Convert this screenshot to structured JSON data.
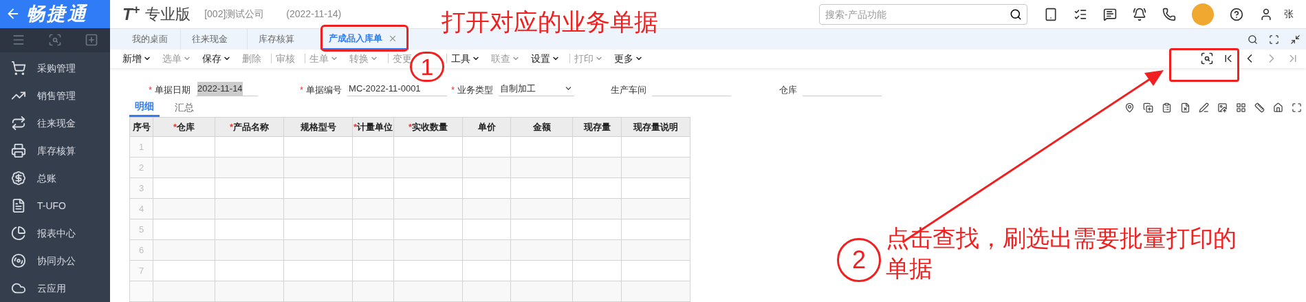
{
  "sidebar": {
    "logo": "畅捷通",
    "items": [
      {
        "label": "采购管理"
      },
      {
        "label": "销售管理"
      },
      {
        "label": "往来现金"
      },
      {
        "label": "库存核算"
      },
      {
        "label": "总账"
      },
      {
        "label": "T-UFO"
      },
      {
        "label": "报表中心"
      },
      {
        "label": "协同办公"
      },
      {
        "label": "云应用"
      }
    ]
  },
  "header": {
    "product_mark": "T$^{+}$",
    "edition": "专业版",
    "company": "[002]测试公司",
    "date": "(2022-11-14)",
    "search": {
      "placeholder": "搜索-产品功能"
    },
    "user": "张"
  },
  "tabs": [
    {
      "label": "我的桌面",
      "selected": false,
      "closable": false
    },
    {
      "label": "往来现金",
      "selected": false,
      "closable": false
    },
    {
      "label": "库存核算",
      "selected": false,
      "closable": false
    },
    {
      "label": "产成品入库单",
      "selected": true,
      "closable": true
    }
  ],
  "toolbar": [
    {
      "label": "新增",
      "dropdown": true,
      "disabled": false
    },
    {
      "label": "选单",
      "dropdown": true,
      "disabled": true
    },
    {
      "label": "保存",
      "dropdown": true,
      "disabled": false
    },
    {
      "label": "删除",
      "dropdown": false,
      "disabled": true
    },
    {
      "label": "审核",
      "dropdown": false,
      "disabled": true,
      "divider_before": true
    },
    {
      "label": "生单",
      "dropdown": true,
      "disabled": true,
      "divider_before": true
    },
    {
      "label": "转换",
      "dropdown": true,
      "disabled": true
    },
    {
      "label": "变更",
      "dropdown": false,
      "disabled": true,
      "divider_before": true
    },
    {
      "label": "工具",
      "dropdown": true,
      "disabled": false,
      "divider_before": true
    },
    {
      "label": "联查",
      "dropdown": true,
      "disabled": true
    },
    {
      "label": "设置",
      "dropdown": true,
      "disabled": false
    },
    {
      "label": "打印",
      "dropdown": true,
      "disabled": true,
      "divider_before": true
    },
    {
      "label": "更多",
      "dropdown": true,
      "disabled": false
    }
  ],
  "form_fields": [
    {
      "required_mark": "*",
      "label": "单据日期",
      "value": "2022-11-14",
      "kind": "text",
      "highlighted": true
    },
    {
      "required_mark": "*",
      "label": "单据编号",
      "value": "MC-2022-11-0001",
      "kind": "text",
      "highlighted": false
    },
    {
      "required_mark": "*",
      "label": "业务类型",
      "value": "自制加工",
      "kind": "select",
      "highlighted": false
    },
    {
      "label": "生产车间",
      "kind": "text"
    },
    {
      "label": "仓库",
      "kind": "text"
    }
  ],
  "detail_tabs": [
    {
      "label": "明细",
      "selected": true
    },
    {
      "label": "汇总",
      "selected": false
    }
  ],
  "table": {
    "columns": [
      {
        "label": "序号"
      },
      {
        "required_mark": "*",
        "label": "仓库"
      },
      {
        "required_mark": "*",
        "label": "产品名称"
      },
      {
        "label": "规格型号"
      },
      {
        "required_mark": "*",
        "label": "计量单位"
      },
      {
        "required_mark": "*",
        "label": "实收数量"
      },
      {
        "label": "单价"
      },
      {
        "label": "金额"
      },
      {
        "label": "现存量"
      },
      {
        "label": "现存量说明"
      }
    ],
    "rows": [
      "1",
      "2",
      "3",
      "4",
      "5",
      "6",
      "7"
    ]
  },
  "annotations": {
    "top_note": "打开对应的业务单据",
    "step_1": "1",
    "step_2": "2",
    "bottom_note": "点击查找，刷选出需要批量打印的单据"
  }
}
